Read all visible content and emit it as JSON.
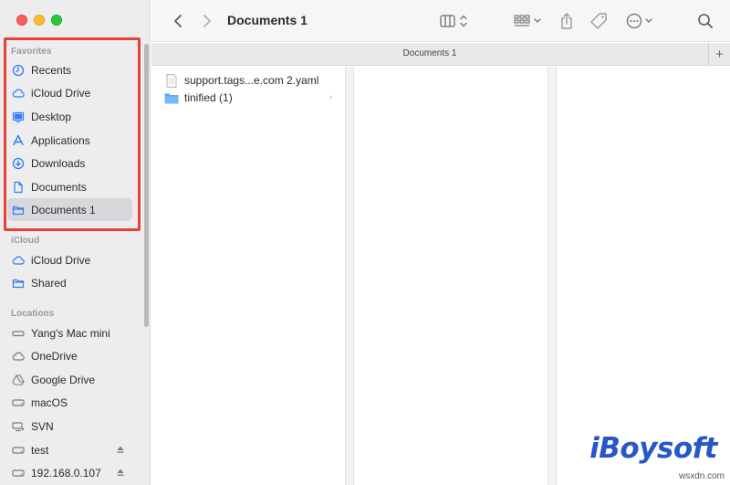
{
  "window": {
    "title": "Documents 1"
  },
  "path_tab": {
    "label": "Documents 1",
    "add_label": "+"
  },
  "sidebar": {
    "sections": [
      {
        "label": "Favorites",
        "items": [
          {
            "label": "Recents",
            "icon": "clock-icon"
          },
          {
            "label": "iCloud Drive",
            "icon": "cloud-icon"
          },
          {
            "label": "Desktop",
            "icon": "desktop-icon"
          },
          {
            "label": "Applications",
            "icon": "applications-icon"
          },
          {
            "label": "Downloads",
            "icon": "download-icon"
          },
          {
            "label": "Documents",
            "icon": "document-icon"
          },
          {
            "label": "Documents 1",
            "icon": "folder-icon",
            "selected": true
          }
        ]
      },
      {
        "label": "iCloud",
        "items": [
          {
            "label": "iCloud Drive",
            "icon": "cloud-icon"
          },
          {
            "label": "Shared",
            "icon": "shared-folder-icon"
          }
        ]
      },
      {
        "label": "Locations",
        "items": [
          {
            "label": "Yang's Mac mini",
            "icon": "computer-icon"
          },
          {
            "label": "OneDrive",
            "icon": "cloud-icon"
          },
          {
            "label": "Google Drive",
            "icon": "drive-icon"
          },
          {
            "label": "macOS",
            "icon": "disk-icon"
          },
          {
            "label": "SVN",
            "icon": "network-icon"
          },
          {
            "label": "test",
            "icon": "disk-icon",
            "ejectable": true
          },
          {
            "label": "192.168.0.107",
            "icon": "disk-icon",
            "ejectable": true
          }
        ]
      }
    ]
  },
  "files": [
    {
      "name": "support.tags...e.com 2.yaml",
      "icon": "yaml-file-icon"
    },
    {
      "name": "tinified (1)",
      "icon": "folder-icon",
      "has_children": true
    }
  ],
  "watermark": {
    "brand": "iBoysoft",
    "site": "wsxdn.com"
  },
  "colors": {
    "accent": "#2f7cf6",
    "highlight_box": "#e5423a",
    "selection": "#d8d8dc",
    "brand": "#2757c8"
  }
}
